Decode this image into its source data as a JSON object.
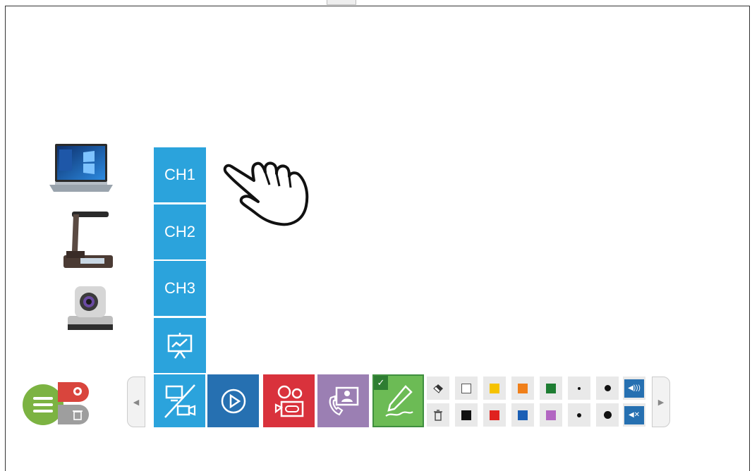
{
  "channels": [
    {
      "label": "CH1"
    },
    {
      "label": "CH2"
    },
    {
      "label": "CH3"
    }
  ],
  "devices": [
    "laptop",
    "document-camera",
    "ptz-camera"
  ],
  "toolbar": {
    "buttons": [
      "switch-source",
      "play",
      "record",
      "call",
      "pen"
    ],
    "active": "pen",
    "colors_row1": [
      "#ffffff",
      "#f5c200",
      "#f07f1a",
      "#1e7d32"
    ],
    "colors_row2": [
      "#111111",
      "#e0221f",
      "#1b5fb5",
      "#b266c2"
    ],
    "speaker_on_icon": "speaker-on-icon",
    "speaker_mute_icon": "speaker-mute-icon"
  },
  "colors": {
    "channel_blue": "#2ba3dc",
    "dark_blue": "#2670b1",
    "record_red": "#d9323c",
    "call_purple": "#9b7fb3",
    "pen_green": "#6cbb55",
    "menu_green": "#7cb342"
  }
}
